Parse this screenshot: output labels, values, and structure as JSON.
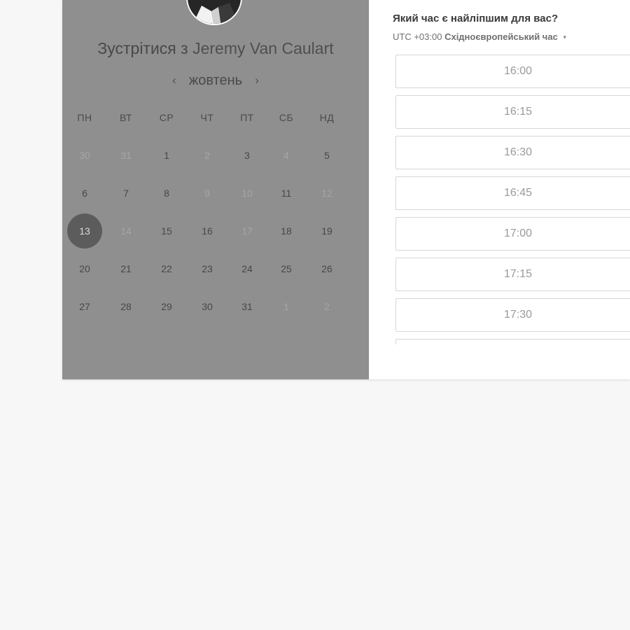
{
  "calendar": {
    "meet_prefix": "Зустрітися з",
    "host_name": "Jeremy Van Caulart",
    "month": "жовтень",
    "prev_arrow": "‹",
    "next_arrow": "›",
    "weekdays": [
      "ПН",
      "ВТ",
      "СР",
      "ЧТ",
      "ПТ",
      "СБ",
      "НД"
    ],
    "weeks": [
      [
        {
          "d": "30",
          "m": true
        },
        {
          "d": "31",
          "m": true
        },
        {
          "d": "1"
        },
        {
          "d": "2",
          "m": true
        },
        {
          "d": "3"
        },
        {
          "d": "4",
          "m": true
        },
        {
          "d": "5"
        }
      ],
      [
        {
          "d": "6"
        },
        {
          "d": "7"
        },
        {
          "d": "8"
        },
        {
          "d": "9",
          "m": true
        },
        {
          "d": "10",
          "m": true
        },
        {
          "d": "11"
        },
        {
          "d": "12",
          "m": true
        }
      ],
      [
        {
          "d": "13",
          "s": true
        },
        {
          "d": "14",
          "m": true
        },
        {
          "d": "15"
        },
        {
          "d": "16"
        },
        {
          "d": "17",
          "m": true
        },
        {
          "d": "18"
        },
        {
          "d": "19"
        }
      ],
      [
        {
          "d": "20"
        },
        {
          "d": "21"
        },
        {
          "d": "22"
        },
        {
          "d": "23"
        },
        {
          "d": "24"
        },
        {
          "d": "25"
        },
        {
          "d": "26"
        }
      ],
      [
        {
          "d": "27"
        },
        {
          "d": "28"
        },
        {
          "d": "29"
        },
        {
          "d": "30"
        },
        {
          "d": "31"
        },
        {
          "d": "1",
          "m": true
        },
        {
          "d": "2",
          "m": true
        }
      ]
    ]
  },
  "times": {
    "question": "Який час є найліпшим для вас?",
    "tz_offset": "UTC +03:00",
    "tz_name": "Східноєвропейський час",
    "tz_caret": "▾",
    "slots": [
      "16:00",
      "16:15",
      "16:30",
      "16:45",
      "17:00",
      "17:15",
      "17:30",
      ""
    ]
  },
  "colors": {
    "page_bg": "#f7f7f7",
    "calendar_overlay": "#8f8f8f",
    "selected_day": "#5c5c5c",
    "slot_border": "#d6d6d6",
    "slot_text": "#9a9a9a"
  }
}
